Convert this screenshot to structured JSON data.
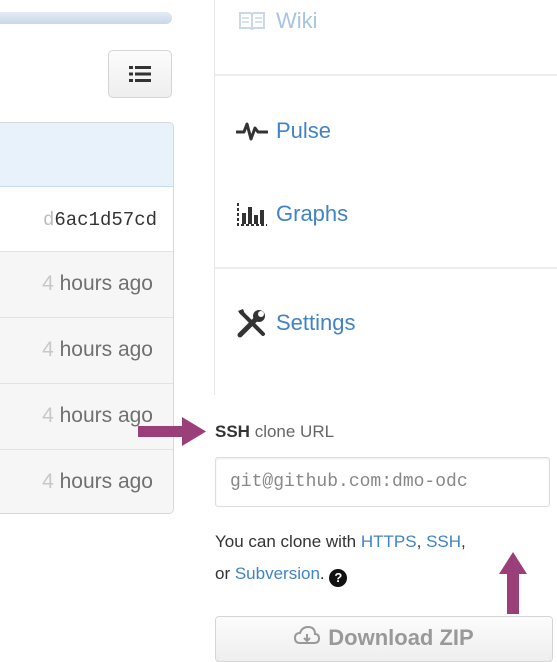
{
  "commits": {
    "sha_faded": "d",
    "sha": "6ac1d57cd",
    "rows": [
      {
        "faded": "4",
        "text": " hours ago"
      },
      {
        "faded": "4",
        "text": " hours ago"
      },
      {
        "faded": "4",
        "text": " hours ago"
      },
      {
        "faded": "4",
        "text": " hours ago"
      }
    ]
  },
  "sidebar": {
    "wiki": "Wiki",
    "pulse": "Pulse",
    "graphs": "Graphs",
    "settings": "Settings"
  },
  "clone": {
    "label_bold": "SSH",
    "label_rest": " clone URL",
    "url": "git@github.com:dmo-odc"
  },
  "help": {
    "prefix": "You can clone with ",
    "https": "HTTPS",
    "comma": ", ",
    "ssh": "SSH",
    "mid": ",",
    "or": "or ",
    "subversion": "Subversion",
    "suffix": ".",
    "help_glyph": "?"
  },
  "download": {
    "label": "Download ZIP"
  },
  "colors": {
    "link": "#4183c4",
    "annotation_arrow": "#9b3f7a"
  }
}
